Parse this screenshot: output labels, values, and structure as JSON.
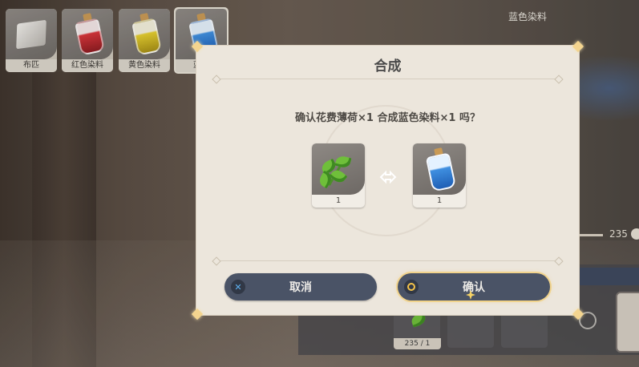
{
  "top_tabs": [
    {
      "label": "布匹",
      "icon": "cloth-icon"
    },
    {
      "label": "红色染料",
      "icon": "red-dye-bottle-icon",
      "color": "#c0272d"
    },
    {
      "label": "黄色染料",
      "icon": "yellow-dye-bottle-icon",
      "color": "#d9c12a"
    },
    {
      "label": "蓝色",
      "icon": "blue-dye-bottle-icon",
      "color": "#2d73d2",
      "active": true
    }
  ],
  "header_right": {
    "title": "蓝色染料"
  },
  "background": {
    "count": "235",
    "slot_label": "235 / 1"
  },
  "dialog": {
    "title": "合成",
    "message": "确认花费薄荷×1 合成蓝色染料×1 吗？",
    "input_item": {
      "name": "薄荷",
      "icon": "mint-icon",
      "qty": "1"
    },
    "output_item": {
      "name": "蓝色染料",
      "icon": "blue-dye-bottle-icon",
      "qty": "1"
    },
    "cancel_label": "取消",
    "confirm_label": "确认"
  },
  "colors": {
    "button_bg": "#4a5366",
    "confirm_glow": "#f1d38c",
    "dialog_bg": "#ece6dc"
  }
}
